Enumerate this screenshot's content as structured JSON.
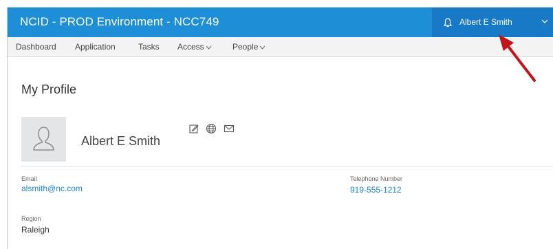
{
  "header": {
    "title": "NCID - PROD Environment - NCC749",
    "user_name": "Albert E Smith",
    "icons": {
      "notifications": "bell-icon",
      "user_menu": "chevron-down-icon"
    }
  },
  "nav": {
    "items": [
      {
        "label": "Dashboard"
      },
      {
        "label": "Application"
      },
      {
        "label": "Tasks"
      },
      {
        "label": "Access",
        "dropdown": true
      },
      {
        "label": "People",
        "dropdown": true
      }
    ]
  },
  "main": {
    "title": "My Profile",
    "profile": {
      "name": "Albert E Smith",
      "action_icons": [
        "edit-icon",
        "globe-icon",
        "mail-icon"
      ]
    },
    "fields": {
      "email": {
        "label": "Email",
        "value": "alsmith@nc.com"
      },
      "telephone": {
        "label": "Telephone Number",
        "value": "919-555-1212"
      },
      "region": {
        "label": "Region",
        "value": "Raleigh"
      }
    }
  },
  "colors": {
    "header": "#1e8fd6",
    "header_user_area": "#1879c7",
    "link": "#1e88d2",
    "annotation_arrow": "#c0151b"
  }
}
